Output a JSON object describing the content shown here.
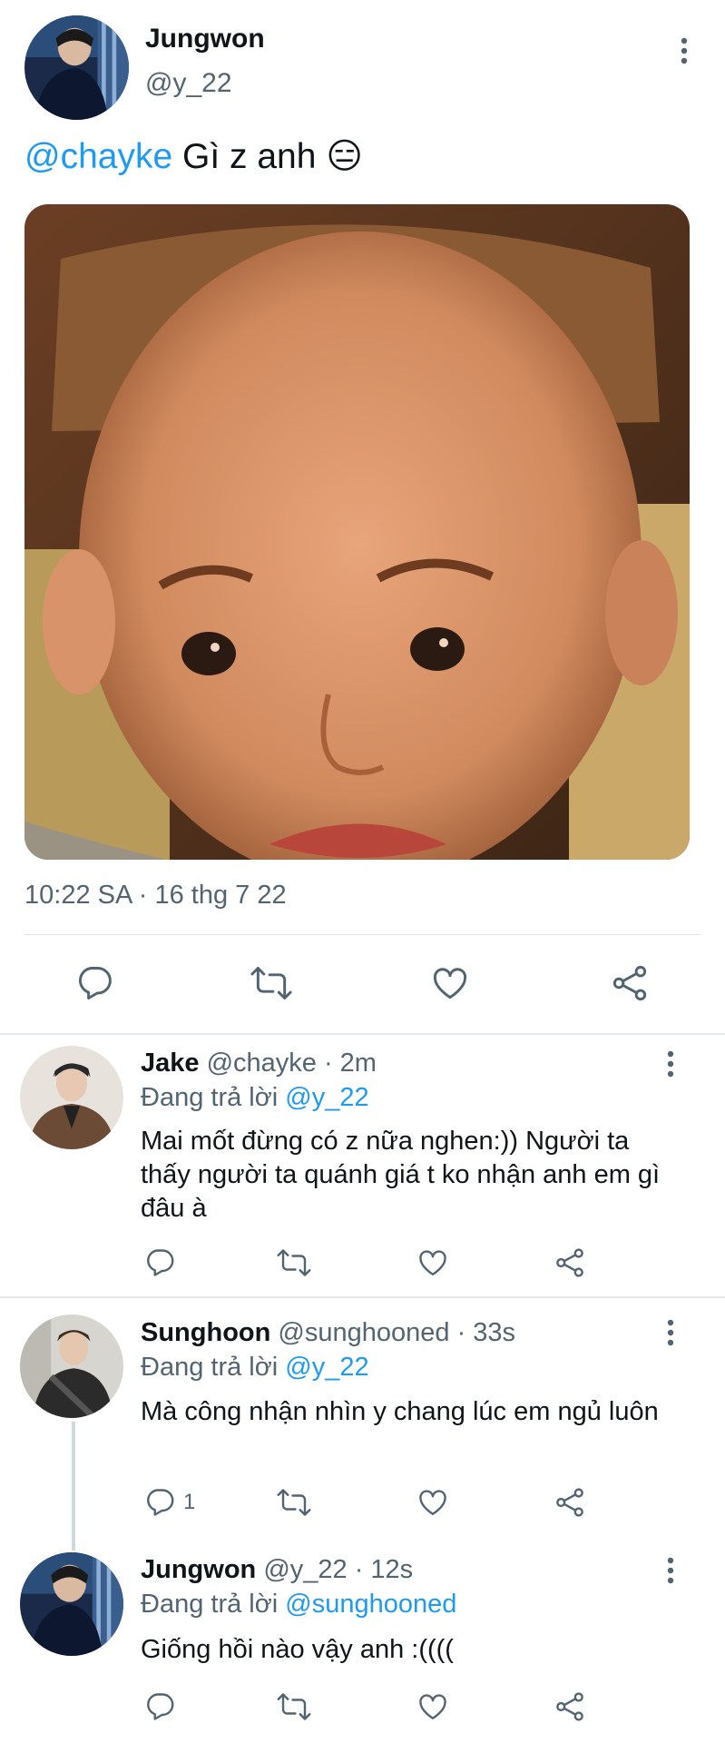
{
  "main_tweet": {
    "author_name": "Jungwon",
    "author_handle": "@y_22",
    "mention": "@chayke",
    "text": " Gì z anh ",
    "emoji": "😑",
    "timestamp": "10:22 SA · 16 thg 7 22"
  },
  "replies": [
    {
      "name": "Jake",
      "handle": "@chayke",
      "time": " · 2m",
      "replying_prefix": "Đang trả lời ",
      "replying_to": "@y_22",
      "text": "Mai mốt đừng có z nữa nghen:)) Người ta thấy người ta quánh giá t ko nhận anh em gì đâu à",
      "reply_count": ""
    },
    {
      "name": "Sunghoon",
      "handle": "@sunghooned",
      "time": " · 33s",
      "replying_prefix": "Đang trả lời ",
      "replying_to": "@y_22",
      "text": "Mà công nhận nhìn y chang lúc em ngủ luôn",
      "reply_count": "1"
    },
    {
      "name": "Jungwon",
      "handle": "@y_22",
      "time": " · 12s",
      "replying_prefix": "Đang trả lời ",
      "replying_to": "@sunghooned",
      "text": "Giống hồi nào vậy anh :((((",
      "reply_count": ""
    }
  ],
  "icons": {
    "reply": "reply-icon",
    "retweet": "retweet-icon",
    "like": "like-icon",
    "share": "share-icon",
    "more": "more-vertical-icon"
  },
  "colors": {
    "accent": "#1d9bf0",
    "secondary_text": "#536471",
    "primary_text": "#0f1419",
    "divider": "#e5e8eb"
  }
}
